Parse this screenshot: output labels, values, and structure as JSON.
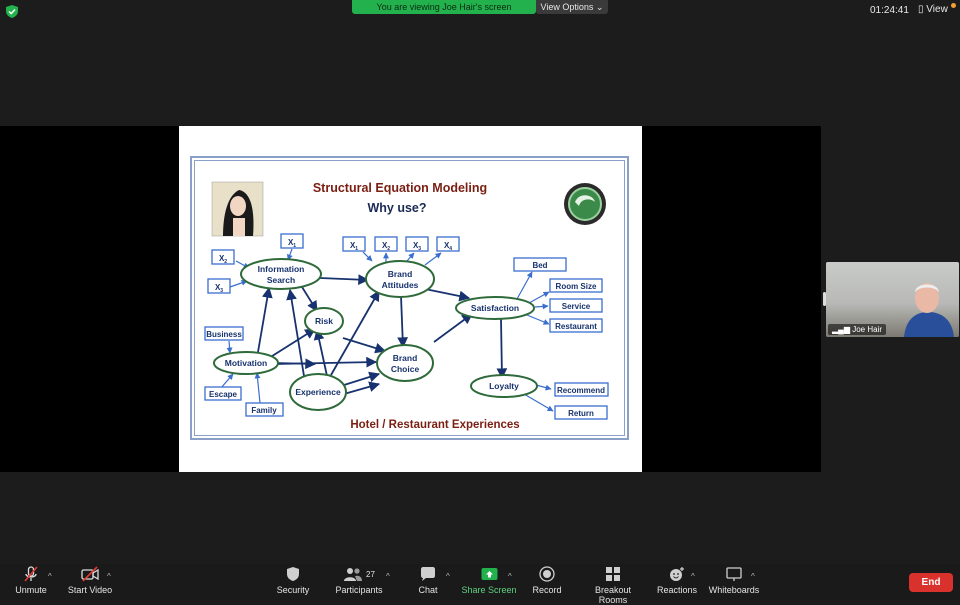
{
  "banner": {
    "text": "You are viewing Joe Hair's screen",
    "view_options": "View Options"
  },
  "top_right": {
    "time": "01:24:41",
    "view": "View"
  },
  "slide": {
    "title_line1": "Structural Equation Modeling",
    "title_line2": "Why use?",
    "footer": "Hotel / Restaurant Experiences",
    "nodes": {
      "information_search": [
        "Information",
        "Search"
      ],
      "brand_attitudes": [
        "Brand",
        "Attitudes"
      ],
      "satisfaction": "Satisfaction",
      "risk": "Risk",
      "motivation": "Motivation",
      "brand_choice": [
        "Brand",
        "Choice"
      ],
      "experience": "Experience",
      "loyalty": "Loyalty"
    },
    "indicators": {
      "x": "X",
      "business": "Business",
      "escape": "Escape",
      "family": "Family",
      "bed": "Bed",
      "room_size": "Room Size",
      "service": "Service",
      "restaurant": "Restaurant",
      "recommend": "Recommend",
      "return": "Return"
    },
    "x_subscripts": {
      "is1": "1",
      "is2": "2",
      "is3": "3",
      "ba1": "1",
      "ba2": "2",
      "ba3": "3",
      "ba4": "4"
    }
  },
  "video": {
    "name": "Joe Hair"
  },
  "toolbar": {
    "unmute": "Unmute",
    "start_video": "Start Video",
    "security": "Security",
    "participants": "Participants",
    "participants_count": "27",
    "chat": "Chat",
    "share_screen": "Share Screen",
    "record": "Record",
    "breakout_rooms": "Breakout Rooms",
    "reactions": "Reactions",
    "whiteboards": "Whiteboards",
    "end": "End"
  },
  "colors": {
    "title_red": "#7a1f12",
    "node_blue": "#17326e",
    "box_blue": "#3a6ecf",
    "banner_green": "#22b14c",
    "end_red": "#d9312b"
  }
}
